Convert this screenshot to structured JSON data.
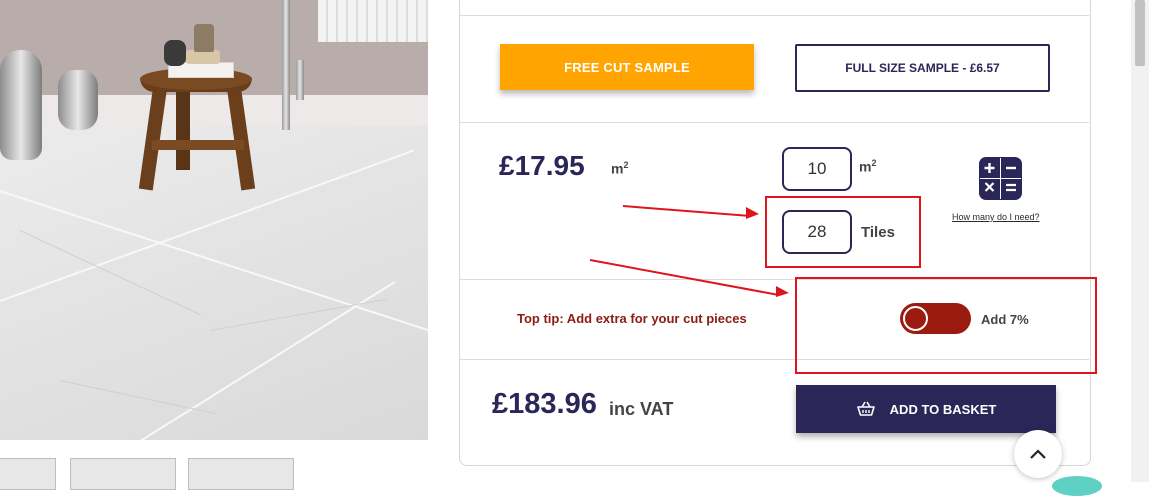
{
  "samples": {
    "free_label": "FREE CUT SAMPLE",
    "full_label": "FULL SIZE SAMPLE - £6.57"
  },
  "pricing": {
    "unit_price": "£17.95",
    "unit": "m",
    "unit_sup": "2"
  },
  "quantity": {
    "area_value": "10",
    "area_unit": "m",
    "area_unit_sup": "2",
    "tiles_value": "28",
    "tiles_unit": "Tiles"
  },
  "calculator": {
    "link_label": "How many do I need?",
    "icon": "calculator-icon"
  },
  "tip": {
    "text": "Top tip: Add extra for your cut pieces",
    "toggle_label": "Add 7%",
    "toggle_on": true
  },
  "total": {
    "amount": "£183.96",
    "vat_label": "inc VAT"
  },
  "basket": {
    "label": "ADD TO BASKET",
    "icon": "basket-icon"
  },
  "colors": {
    "brand_navy": "#2a2658",
    "sample_orange": "#ffa400",
    "toggle_red": "#9c1b10",
    "annotation_red": "#e0141b"
  }
}
